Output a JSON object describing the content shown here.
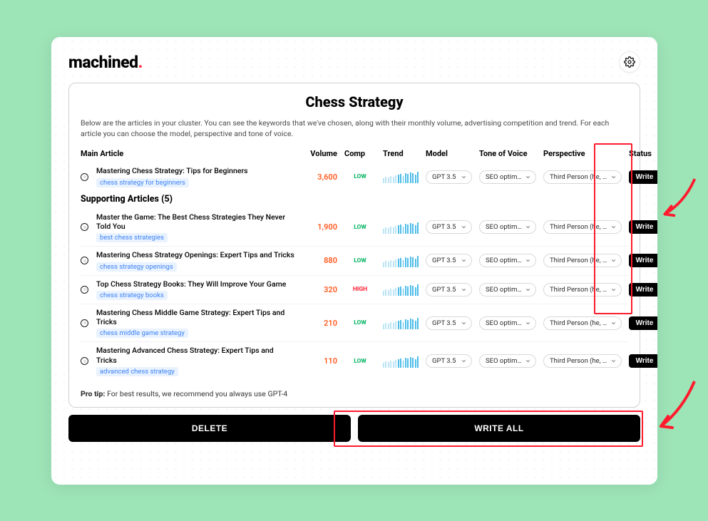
{
  "brand": {
    "name": "machined",
    "dot": "."
  },
  "page": {
    "title": "Chess Strategy",
    "intro": "Below are the articles in your cluster. You can see the keywords that we've chosen, along with their monthly volume, advertising competition and trend. For each article you can choose the model, perspective and tone of voice."
  },
  "columns": {
    "main_label": "Main Article",
    "volume": "Volume",
    "comp": "Comp",
    "trend": "Trend",
    "model": "Model",
    "tone": "Tone of Voice",
    "perspective": "Perspective",
    "status": "Status"
  },
  "supporting_header": "Supporting Articles (5)",
  "options": {
    "model": "GPT 3.5",
    "tone": "SEO optimized (",
    "perspective": "Third Person (he, she, it, t"
  },
  "buttons": {
    "write": "Write",
    "delete": "DELETE",
    "write_all": "WRITE ALL"
  },
  "protip": {
    "label": "Pro tip:",
    "text": " For best results, we recommend you always use GPT-4"
  },
  "main_article": {
    "title": "Mastering Chess Strategy: Tips for Beginners",
    "keyword": "chess strategy for beginners",
    "volume": "3,600",
    "comp": "LOW"
  },
  "supporting": [
    {
      "title": "Master the Game: The Best Chess Strategies They Never Told You",
      "keyword": "best chess strategies",
      "volume": "1,900",
      "comp": "LOW"
    },
    {
      "title": "Mastering Chess Strategy Openings: Expert Tips and Tricks",
      "keyword": "chess strategy openings",
      "volume": "880",
      "comp": "LOW"
    },
    {
      "title": "Top Chess Strategy Books: They Will Improve Your Game",
      "keyword": "chess strategy books",
      "volume": "320",
      "comp": "HIGH"
    },
    {
      "title": "Mastering Chess Middle Game Strategy: Expert Tips and Tricks",
      "keyword": "chess middle game strategy",
      "volume": "210",
      "comp": "LOW"
    },
    {
      "title": "Mastering Advanced Chess Strategy: Expert Tips and Tricks",
      "keyword": "advanced chess strategy",
      "volume": "110",
      "comp": "LOW"
    }
  ]
}
